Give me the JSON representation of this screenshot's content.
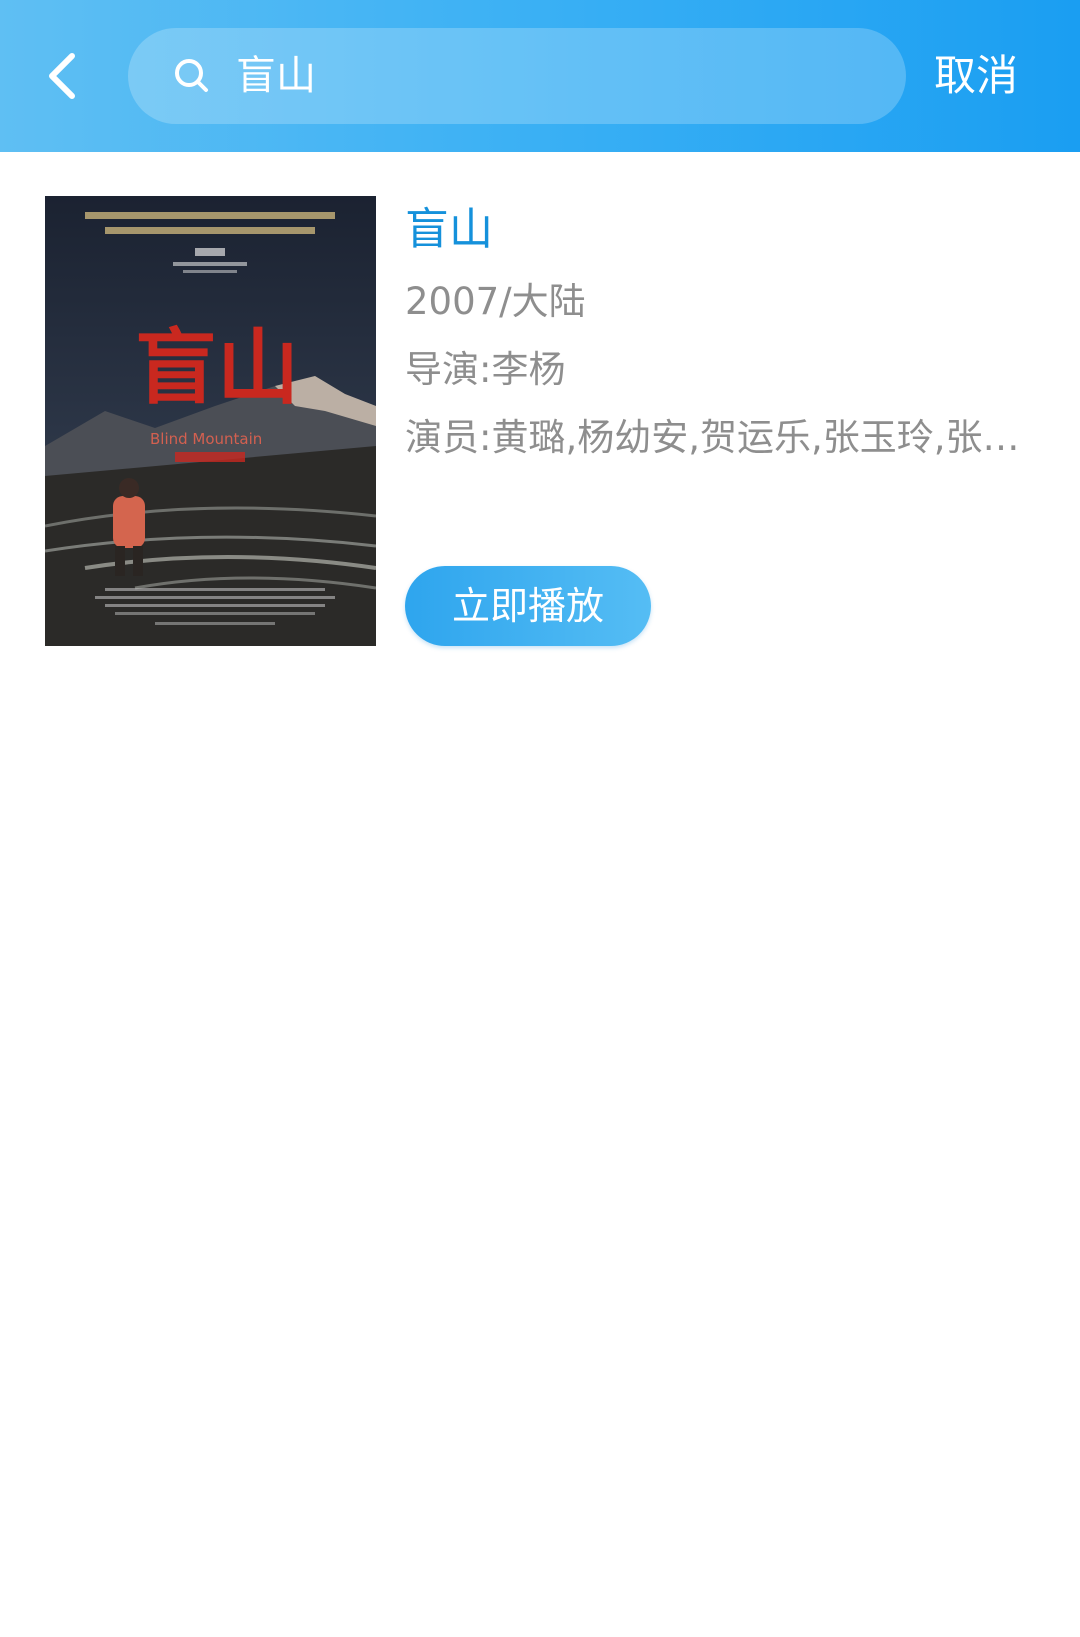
{
  "header": {
    "search_query": "盲山",
    "cancel_label": "取消"
  },
  "result": {
    "poster_title": "盲山",
    "poster_english": "Blind Mountain",
    "title": "盲山",
    "year_region": "2007/大陆",
    "director": "导演:李杨",
    "actors": "演员:黄璐,杨幼安,贺运乐,张玉玲,张…",
    "play_label": "立即播放"
  },
  "colors": {
    "header_start": "#5fbff3",
    "header_end": "#1a9ef2",
    "title_blue": "#1591db",
    "meta_gray": "#8e8e8e"
  }
}
